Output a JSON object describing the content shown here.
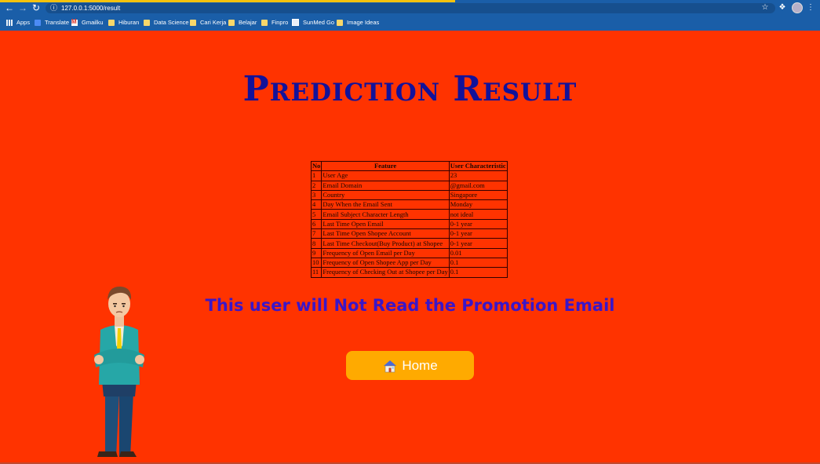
{
  "browser": {
    "url": "127.0.0.1:5000/result",
    "bookmarks": [
      {
        "label": "Apps",
        "icon": "apps-icon"
      },
      {
        "label": "Translate",
        "icon": "translate-icon"
      },
      {
        "label": "Gmailku",
        "icon": "gmail-icon"
      },
      {
        "label": "Hiburan",
        "icon": "folder-icon"
      },
      {
        "label": "Data Science",
        "icon": "folder-icon"
      },
      {
        "label": "Cari Kerja",
        "icon": "folder-icon"
      },
      {
        "label": "Belajar",
        "icon": "folder-icon"
      },
      {
        "label": "Finpro",
        "icon": "folder-icon"
      },
      {
        "label": "SunMed Go",
        "icon": "site-icon"
      },
      {
        "label": "Image Ideas",
        "icon": "folder-icon"
      }
    ]
  },
  "page": {
    "title": "Prediction Result",
    "result_text": "This user will Not Read the Promotion Email",
    "home_label": "Home"
  },
  "table": {
    "headers": [
      "No",
      "Feature",
      "User Characteristic"
    ],
    "rows": [
      [
        "1",
        "User Age",
        "23"
      ],
      [
        "2",
        "Email Domain",
        "@gmail.com"
      ],
      [
        "3",
        "Country",
        "Singapore"
      ],
      [
        "4",
        "Day When the Email Sent",
        "Monday"
      ],
      [
        "5",
        "Email Subject Character Length",
        "not ideal"
      ],
      [
        "6",
        "Last Time Open Email",
        "0-1 year"
      ],
      [
        "7",
        "Last Time Open Shopee Account",
        "0-1 year"
      ],
      [
        "8",
        "Last Time Checkout(Buy Product) at Shopee",
        "0-1 year"
      ],
      [
        "9",
        "Frequency of Open Email per Day",
        "0.01"
      ],
      [
        "10",
        "Frequency of Open Shopee App per Day",
        "0.1"
      ],
      [
        "11",
        "Frequency of Checking Out at Shopee per Day",
        "0.1"
      ]
    ]
  },
  "colors": {
    "background": "#ff3300",
    "title": "#12129a",
    "result": "#3a16c8",
    "button": "#ffaa00",
    "browser_bar": "#1a5ea8"
  }
}
